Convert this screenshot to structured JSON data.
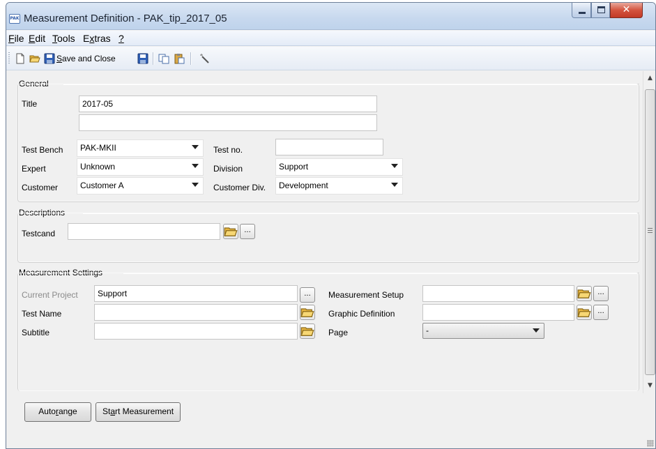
{
  "window": {
    "app_icon_text": "PAK",
    "title": "Measurement Definition - PAK_tip_2017_05"
  },
  "menu": [
    {
      "first": "F",
      "rest": "ile"
    },
    {
      "first": "E",
      "rest": "dit"
    },
    {
      "first": "T",
      "rest": "ools"
    },
    {
      "pre": "E",
      "first": "x",
      "rest": "tras"
    },
    {
      "first": "?",
      "rest": ""
    }
  ],
  "toolbar": {
    "save_close": {
      "first": "S",
      "rest": "ave and Close"
    },
    "icons": [
      "new-document-icon",
      "open-folder-icon",
      "save-icon",
      "save-icon",
      "copy-icon",
      "paste-icon",
      "wand-icon"
    ]
  },
  "general": {
    "group_label": "General",
    "title_label": "Title",
    "title_value": "2017-05",
    "title_value2": "",
    "test_bench_label": "Test Bench",
    "test_bench_value": "PAK-MKII",
    "test_no_label": "Test no.",
    "test_no_value": "",
    "expert_label": "Expert",
    "expert_value": "Unknown",
    "division_label": "Division",
    "division_value": "Support",
    "customer_label": "Customer",
    "customer_value": "Customer A",
    "customer_div_label": "Customer Div.",
    "customer_div_value": "Development"
  },
  "descriptions": {
    "group_label": "Descriptions",
    "testcand_label": "Testcand",
    "testcand_value": "",
    "ellipsis": "..."
  },
  "measurement": {
    "group_label": "Measurement Settings",
    "current_project_label": "Current Project",
    "current_project_value": "Support",
    "test_name_label": "Test Name",
    "test_name_value": "",
    "subtitle_label": "Subtitle",
    "subtitle_value": "",
    "setup_label": "Measurement Setup",
    "setup_value": "",
    "graphic_label": "Graphic Definition",
    "graphic_value": "",
    "page_label": "Page",
    "page_value": "-",
    "ellipsis": "..."
  },
  "buttons": {
    "autorange": {
      "pre": "Auto",
      "first": "r",
      "rest": "ange"
    },
    "start": {
      "pre": "St",
      "first": "a",
      "rest": "rt Measurement"
    }
  }
}
